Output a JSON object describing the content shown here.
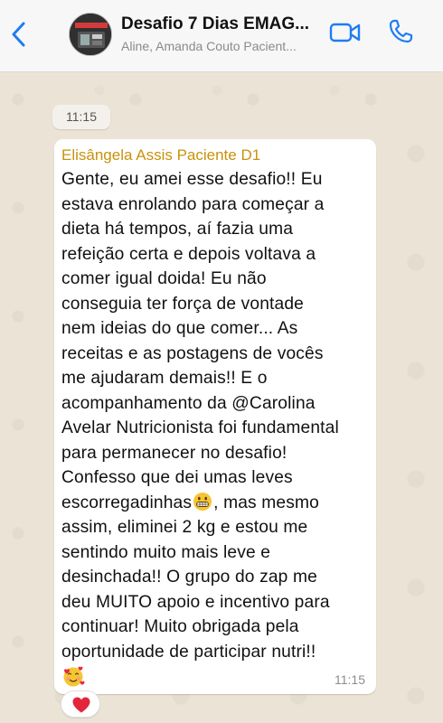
{
  "header": {
    "title": "Desafio 7 Dias EMAG...",
    "subtitle": "Aline, Amanda Couto Pacient...",
    "accent_color": "#1f7cf3",
    "icons": [
      "chevron-left-icon",
      "group-avatar",
      "video-call-icon",
      "phone-icon"
    ]
  },
  "chat": {
    "date_pill": "11:15",
    "message": {
      "sender": "Elisângela Assis Paciente D1",
      "sender_color": "#c8920b",
      "text_part1": "Gente, eu amei esse desafio!! Eu\nestava enrolando para começar a\ndieta há tempos, aí fazia uma\nrefeição certa e depois voltava a\ncomer igual doida! Eu não\nconseguia ter força de vontade\nnem ideias do que comer... As\nreceitas e as postagens de vocês\nme ajudaram demais!! E o\nacompanhamento da @Carolina\nAvelar Nutricionista foi fundamental\npara permanecer no desafio!\nConfesso que dei umas leves\nescorregadinhas",
      "text_part2": ", mas mesmo\nassim, eliminei 2 kg e estou me\nsentindo muito mais leve e\ndesinchada!! O grupo do zap me\ndeu MUITO apoio e incentivo para\ncontinuar! Muito obrigada pela\noportunidade de participar nutri!!",
      "inline_emoji": "grimacing-face",
      "trailing_emoji": "smiling-face-with-hearts",
      "time": "11:15"
    },
    "reaction": "red-heart"
  }
}
